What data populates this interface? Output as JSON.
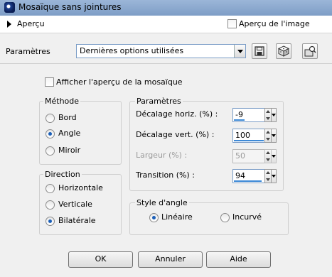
{
  "window": {
    "title": "Mosaïque sans jointures"
  },
  "preview_bar": {
    "label": "Aperçu",
    "show_image_label": "Aperçu de l'image",
    "show_image_checked": false
  },
  "presets": {
    "label": "Paramètres",
    "selected": "Dernières options utilisées"
  },
  "show_mosaic_preview": {
    "label": "Afficher l'aperçu de la mosaïque",
    "checked": false
  },
  "method": {
    "title": "Méthode",
    "options": [
      {
        "label": "Bord",
        "selected": false
      },
      {
        "label": "Angle",
        "selected": true
      },
      {
        "label": "Miroir",
        "selected": false
      }
    ]
  },
  "direction": {
    "title": "Direction",
    "options": [
      {
        "label": "Horizontale",
        "selected": false
      },
      {
        "label": "Verticale",
        "selected": false
      },
      {
        "label": "Bilatérale",
        "selected": true
      }
    ]
  },
  "parameters": {
    "title": "Paramètres",
    "fields": [
      {
        "label": "Décalage horiz. (%) :",
        "value": "-9",
        "fill": 0.35,
        "enabled": true
      },
      {
        "label": "Décalage vert. (%) :",
        "value": "100",
        "fill": 1.0,
        "enabled": true
      },
      {
        "label": "Largeur (%) :",
        "value": "50",
        "fill": 0.5,
        "enabled": false
      },
      {
        "label": "Transition (%) :",
        "value": "94",
        "fill": 0.94,
        "enabled": true
      }
    ]
  },
  "angle_style": {
    "title": "Style d'angle",
    "options": [
      {
        "label": "Linéaire",
        "selected": true
      },
      {
        "label": "Incurvé",
        "selected": false
      }
    ]
  },
  "buttons": {
    "ok": "OK",
    "cancel": "Annuler",
    "help": "Aide"
  },
  "colors": {
    "accent": "#3d89d6",
    "radio_dot": "#1b5fb8",
    "titlebar": "#8aa8cf"
  }
}
